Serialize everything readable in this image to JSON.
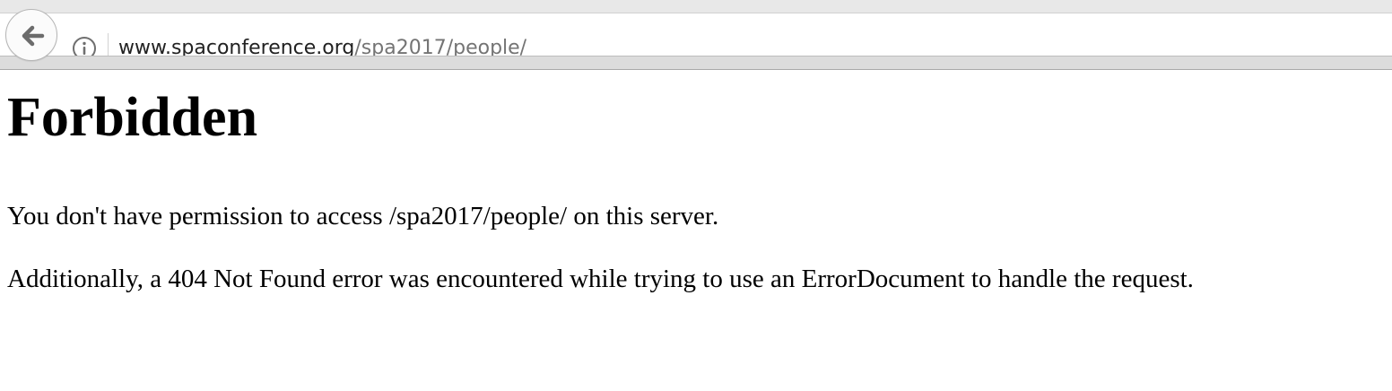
{
  "browser": {
    "url_domain": "www.spaconference.org",
    "url_path": "/spa2017/people/",
    "icons": {
      "back": "back-arrow-icon",
      "info": "info-icon"
    }
  },
  "page": {
    "heading": "Forbidden",
    "message": "You don't have permission to access /spa2017/people/ on this server.",
    "additional": "Additionally, a 404 Not Found error was encountered while trying to use an ErrorDocument to handle the request."
  }
}
